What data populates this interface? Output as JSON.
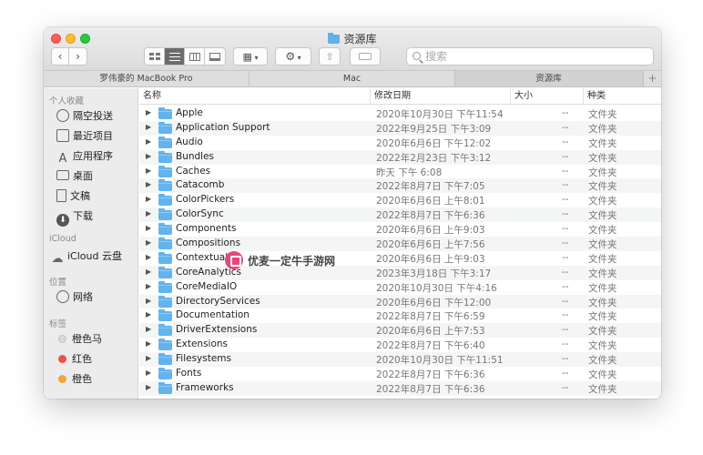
{
  "window": {
    "title": "资源库"
  },
  "toolbar": {
    "back_label": "‹",
    "forward_label": "›",
    "search_placeholder": "搜索"
  },
  "pathbar": {
    "tabs": [
      "罗伟豪的 MacBook Pro",
      "Mac",
      "资源库"
    ],
    "add_label": "+"
  },
  "sidebar": {
    "favorites_header": "个人收藏",
    "favorites": [
      "隔空投送",
      "最近项目",
      "应用程序",
      "桌面",
      "文稿",
      "下载"
    ],
    "icloud_header": "iCloud",
    "icloud_item": "iCloud 云盘",
    "locations_header": "位置",
    "locations": [
      "网络"
    ],
    "tags_header": "标签",
    "tags": [
      {
        "label": "橙色马",
        "color": "#d8d8d8"
      },
      {
        "label": "红色",
        "color": "#f0504d"
      },
      {
        "label": "橙色",
        "color": "#f6a33a"
      }
    ]
  },
  "columns": {
    "name": "名称",
    "date": "修改日期",
    "size": "大小",
    "kind": "种类"
  },
  "files": [
    {
      "name": "Apple",
      "date": "2020年10月30日 下午11:54",
      "size": "--",
      "kind": "文件夹"
    },
    {
      "name": "Application Support",
      "date": "2022年9月25日 下午3:09",
      "size": "--",
      "kind": "文件夹"
    },
    {
      "name": "Audio",
      "date": "2020年6月6日 下午12:02",
      "size": "--",
      "kind": "文件夹"
    },
    {
      "name": "Bundles",
      "date": "2022年2月23日 下午3:12",
      "size": "--",
      "kind": "文件夹"
    },
    {
      "name": "Caches",
      "date": "昨天 下午 6:08",
      "size": "--",
      "kind": "文件夹"
    },
    {
      "name": "Catacomb",
      "date": "2022年8月7日 下午7:05",
      "size": "--",
      "kind": "文件夹"
    },
    {
      "name": "ColorPickers",
      "date": "2020年6月6日 上午8:01",
      "size": "--",
      "kind": "文件夹"
    },
    {
      "name": "ColorSync",
      "date": "2022年8月7日 下午6:36",
      "size": "--",
      "kind": "文件夹"
    },
    {
      "name": "Components",
      "date": "2020年6月6日 上午9:03",
      "size": "--",
      "kind": "文件夹"
    },
    {
      "name": "Compositions",
      "date": "2020年6月6日 上午7:56",
      "size": "--",
      "kind": "文件夹"
    },
    {
      "name": "Contextual",
      "date": "2020年6月6日 上午9:03",
      "size": "--",
      "kind": "文件夹"
    },
    {
      "name": "CoreAnalytics",
      "date": "2023年3月18日 下午3:17",
      "size": "--",
      "kind": "文件夹"
    },
    {
      "name": "CoreMediaIO",
      "date": "2020年10月30日 下午4:16",
      "size": "--",
      "kind": "文件夹"
    },
    {
      "name": "DirectoryServices",
      "date": "2020年6月6日 下午12:00",
      "size": "--",
      "kind": "文件夹"
    },
    {
      "name": "Documentation",
      "date": "2022年8月7日 下午6:59",
      "size": "--",
      "kind": "文件夹"
    },
    {
      "name": "DriverExtensions",
      "date": "2020年6月6日 上午7:53",
      "size": "--",
      "kind": "文件夹"
    },
    {
      "name": "Extensions",
      "date": "2022年8月7日 下午6:40",
      "size": "--",
      "kind": "文件夹"
    },
    {
      "name": "Filesystems",
      "date": "2020年10月30日 下午11:51",
      "size": "--",
      "kind": "文件夹"
    },
    {
      "name": "Fonts",
      "date": "2022年8月7日 下午6:36",
      "size": "--",
      "kind": "文件夹"
    },
    {
      "name": "Frameworks",
      "date": "2022年8月7日 下午6:36",
      "size": "--",
      "kind": "文件夹"
    }
  ],
  "watermark": {
    "text": "优麦一定牛手游网"
  },
  "colors": {
    "folder": "#63b3ee",
    "accent": "#5fb0ec"
  }
}
